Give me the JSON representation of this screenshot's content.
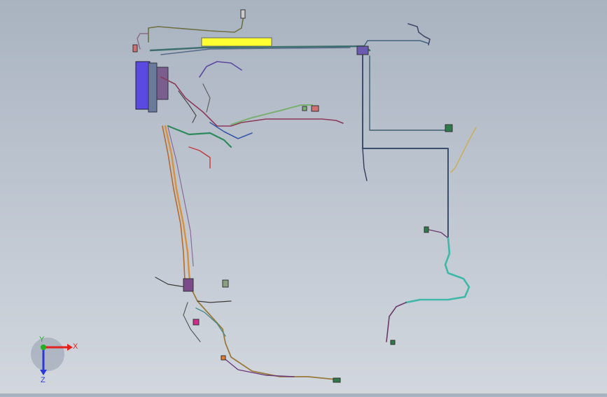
{
  "viewport": {
    "background_top": "#a9b3c0",
    "background_bottom": "#d2d7de"
  },
  "triad": {
    "x_label": "X",
    "y_label": "Y",
    "z_label": "Z",
    "x_color": "#e32222",
    "y_color": "#22b022",
    "z_color": "#2a3ad8"
  },
  "model": {
    "name_icon": "wire-harness-3d-model",
    "label_bar_color": "#ffff33",
    "panel_color": "#6a5ae0"
  }
}
